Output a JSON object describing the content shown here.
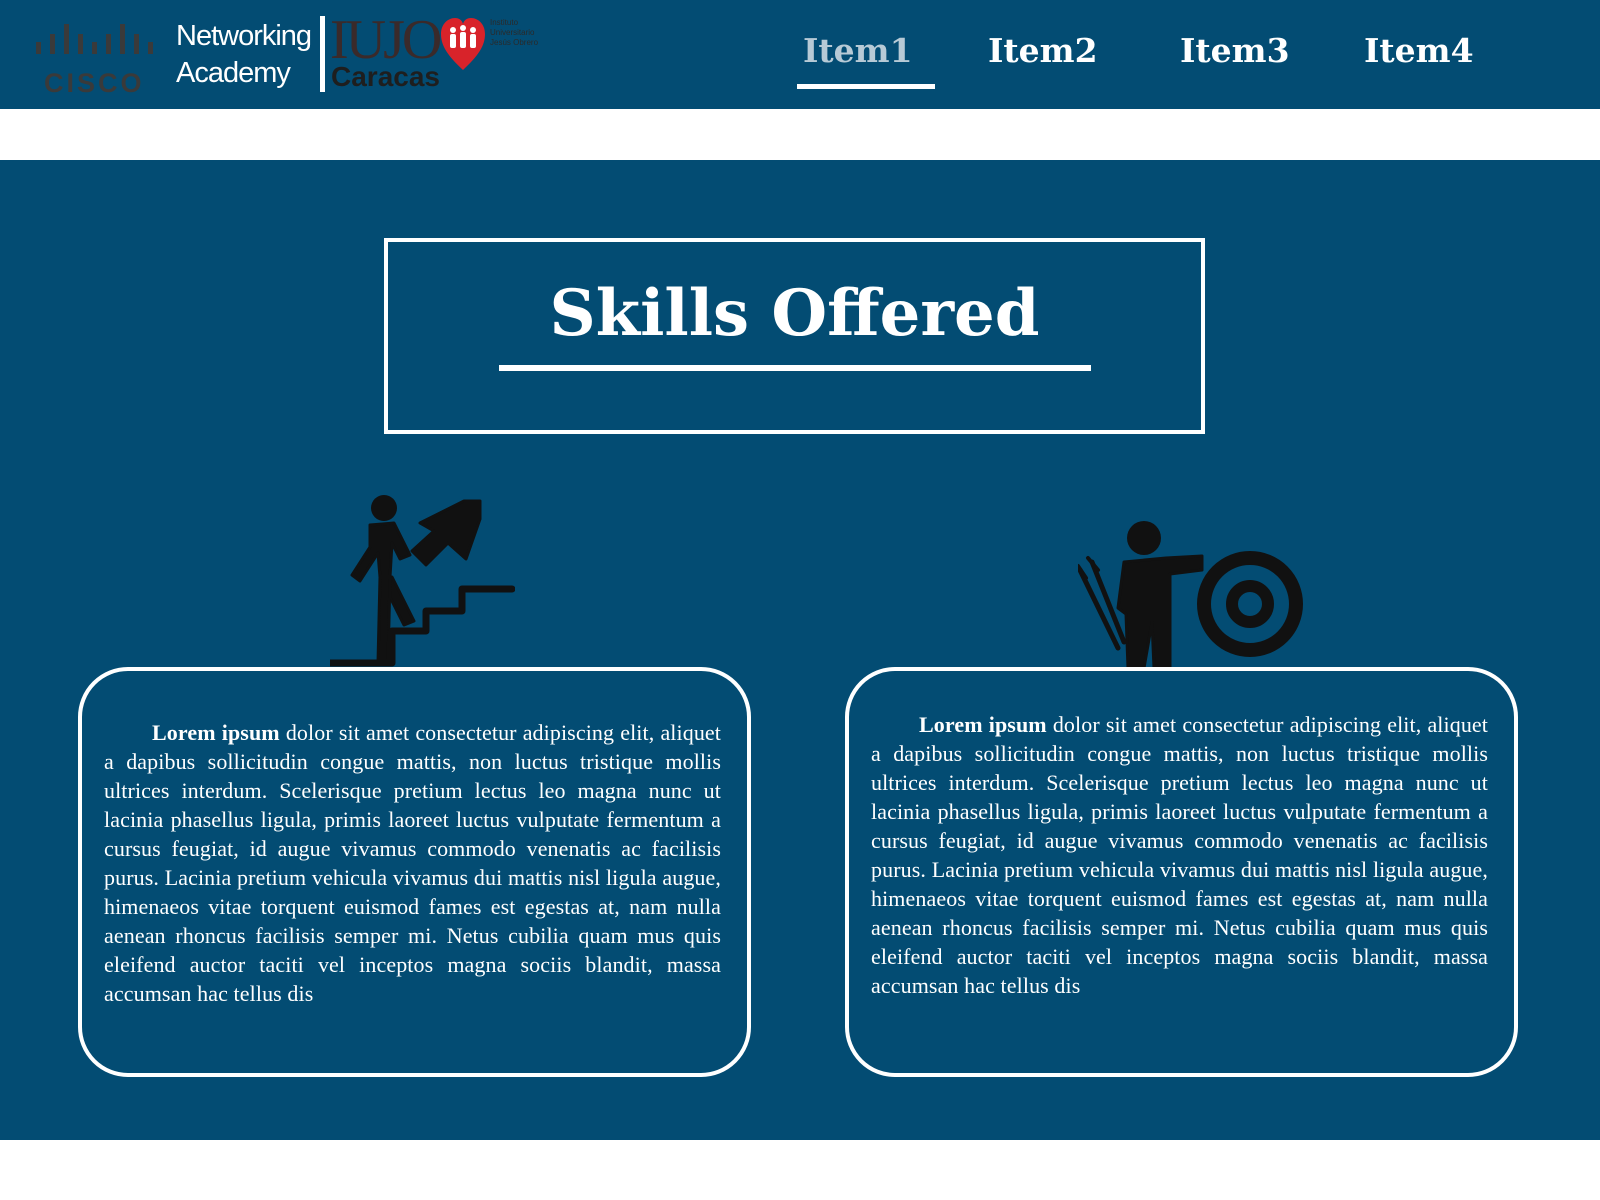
{
  "header": {
    "logo": {
      "cisco_word": "CISCO",
      "academy_line1": "Networking",
      "academy_line2": "Academy",
      "iujo_word": "IUJO",
      "iujo_city": "Caracas",
      "iujo_small_text": "Instituto Universitario Jesús Obrero"
    },
    "nav": [
      {
        "label": "Item1",
        "active": true
      },
      {
        "label": "Item2",
        "active": false
      },
      {
        "label": "Item3",
        "active": false
      },
      {
        "label": "Item4",
        "active": false
      }
    ]
  },
  "main": {
    "title": "Skills Offered",
    "cards": [
      {
        "icon": "stairs-growth-icon",
        "lead": "Lorem ipsum",
        "body": " dolor sit amet consectetur adipiscing elit, aliquet a dapibus sollicitudin congue mattis, non luctus tristique mollis ultrices interdum. Scelerisque pretium lectus leo magna nunc ut lacinia phasellus ligula, primis laoreet luctus vulputate fermentum a cursus feugiat, id augue vivamus commodo venenatis ac facilisis purus. Lacinia pretium vehicula vivamus dui mattis nisl ligula augue, himenaeos vitae torquent euismod fames est egestas at, nam nulla aenean rhoncus facilisis semper mi. Netus cubilia quam mus quis eleifend auctor taciti vel inceptos magna sociis blandit, massa accumsan hac tellus dis"
      },
      {
        "icon": "archer-target-icon",
        "lead": "Lorem ipsum",
        "body": " dolor sit amet consectetur adipiscing elit, aliquet a dapibus sollicitudin congue mattis, non luctus tristique mollis ultrices interdum. Scelerisque pretium lectus leo magna nunc ut lacinia phasellus ligula, primis laoreet luctus vulputate fermentum a cursus feugiat, id augue vivamus commodo venenatis ac facilisis purus. Lacinia pretium vehicula vivamus dui mattis nisl ligula augue, himenaeos vitae torquent euismod fames est egestas at, nam nulla aenean rhoncus facilisis semper mi. Netus cubilia quam mus quis eleifend auctor taciti vel inceptos magna sociis blandit, massa accumsan hac tellus dis"
      }
    ]
  },
  "colors": {
    "primary": "#034c73",
    "text": "#ffffff",
    "nav_active": "#b7cad6"
  }
}
